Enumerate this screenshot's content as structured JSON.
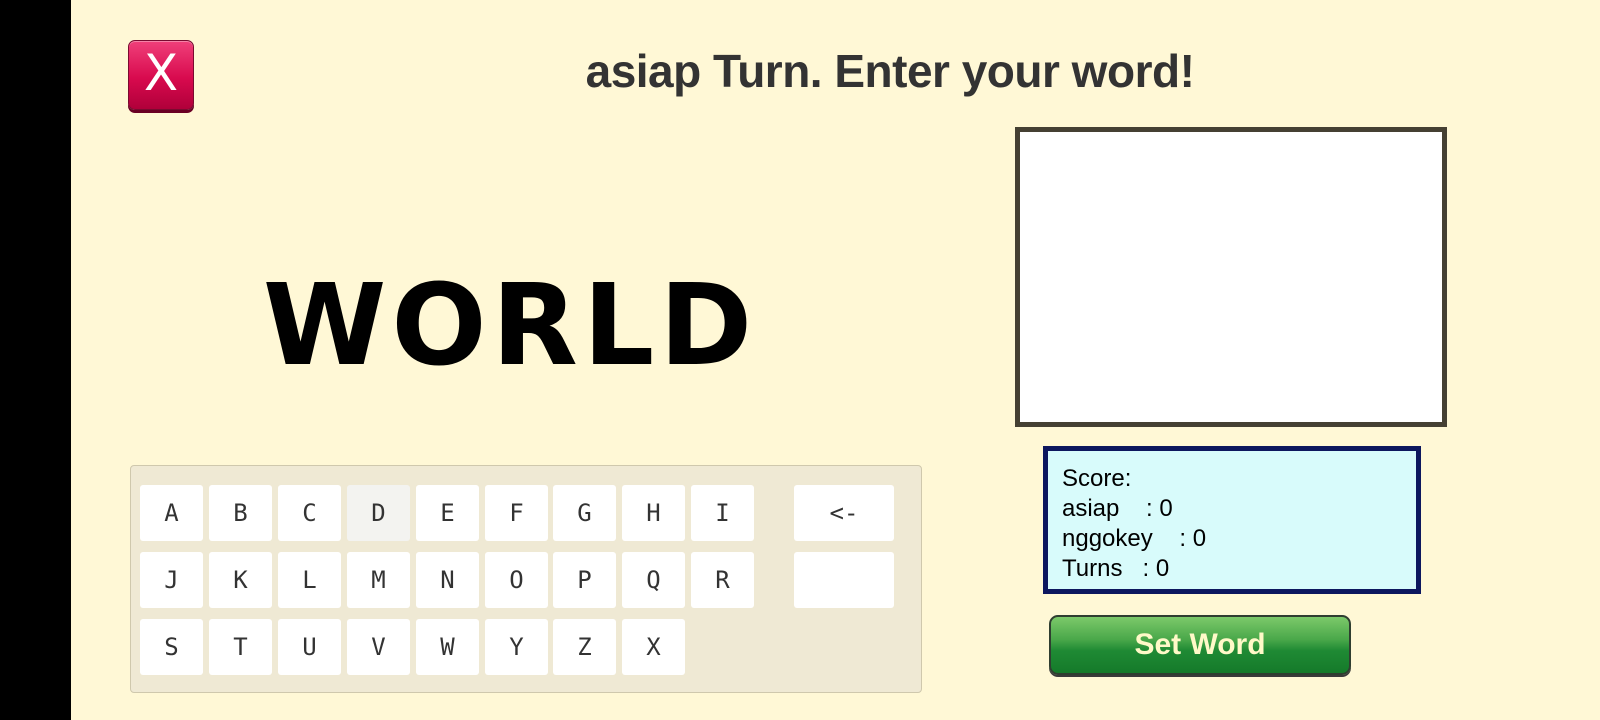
{
  "header": {
    "close_label": "X",
    "title": "asiap Turn. Enter your word!"
  },
  "word_display": "WORLD",
  "keyboard": {
    "row1": [
      "A",
      "B",
      "C",
      "D",
      "E",
      "F",
      "G",
      "H",
      "I"
    ],
    "row2": [
      "J",
      "K",
      "L",
      "M",
      "N",
      "O",
      "P",
      "Q",
      "R"
    ],
    "row3": [
      "S",
      "T",
      "U",
      "V",
      "W",
      "Y",
      "Z",
      "X"
    ],
    "backspace_label": "<-",
    "blank_key_label": "",
    "dimmed_key": "D"
  },
  "scoreboard": {
    "heading": "Score:",
    "rows": [
      {
        "name": "asiap",
        "sep": "    : ",
        "value": "0"
      },
      {
        "name": "nggokey",
        "sep": "    : ",
        "value": "0"
      },
      {
        "name": "Turns",
        "sep": "   : ",
        "value": "0"
      }
    ]
  },
  "set_word_label": "Set Word",
  "colors": {
    "background": "#fff8d6",
    "close_button": "#d80a4e",
    "score_panel": "#d8fbfb",
    "score_border": "#0c175e",
    "set_word_button": "#1f8a34"
  }
}
